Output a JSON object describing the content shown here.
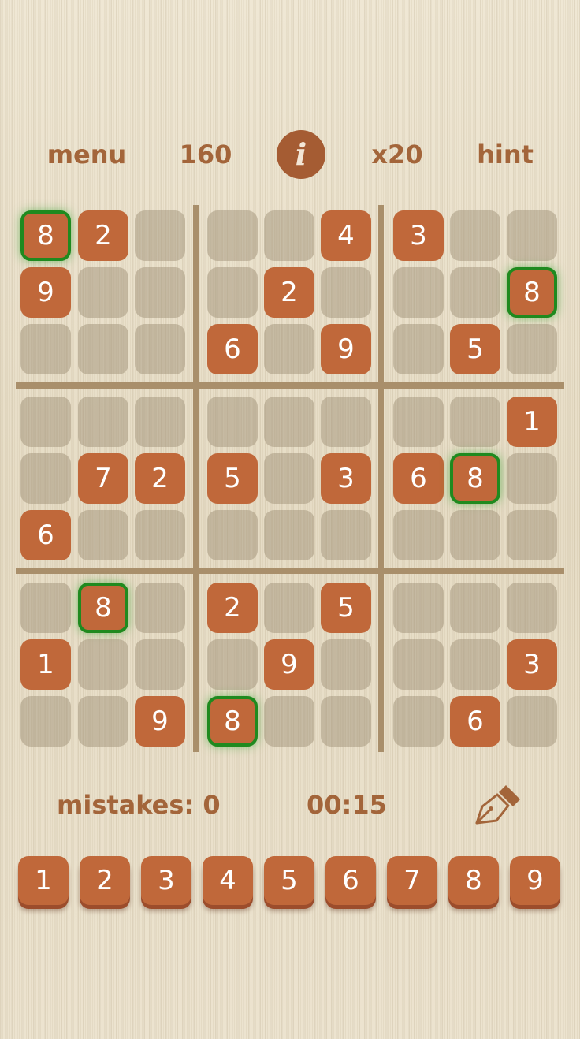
{
  "topbar": {
    "menu_label": "menu",
    "score": "160",
    "info_label": "i",
    "multiplier": "x20",
    "hint_label": "hint"
  },
  "board": {
    "cells": [
      [
        "8",
        "2",
        "",
        "",
        "",
        "4",
        "3",
        "",
        ""
      ],
      [
        "9",
        "",
        "",
        "",
        "2",
        "",
        "",
        "",
        "8"
      ],
      [
        "",
        "",
        "",
        "6",
        "",
        "9",
        "",
        "5",
        ""
      ],
      [
        "",
        "",
        "",
        "",
        "",
        "",
        "",
        "",
        "1"
      ],
      [
        "",
        "7",
        "2",
        "5",
        "",
        "3",
        "6",
        "8",
        ""
      ],
      [
        "6",
        "",
        "",
        "",
        "",
        "",
        "",
        "",
        ""
      ],
      [
        "",
        "8",
        "",
        "2",
        "",
        "5",
        "",
        "",
        ""
      ],
      [
        "1",
        "",
        "",
        "",
        "9",
        "",
        "",
        "",
        "3"
      ],
      [
        "",
        "",
        "9",
        "8",
        "",
        "",
        "",
        "6",
        ""
      ]
    ],
    "highlighted_digit": "8"
  },
  "status": {
    "mistakes_label": "mistakes: 0",
    "timer": "00:15",
    "pencil_icon": "pen-nib-icon"
  },
  "numpad": {
    "keys": [
      "1",
      "2",
      "3",
      "4",
      "5",
      "6",
      "7",
      "8",
      "9"
    ]
  },
  "colors": {
    "tile": "#c0683a",
    "empty_tile": "#a5987d",
    "highlight": "#1f8a1f",
    "text_accent": "#a3653a",
    "divider": "#a98f6b"
  }
}
